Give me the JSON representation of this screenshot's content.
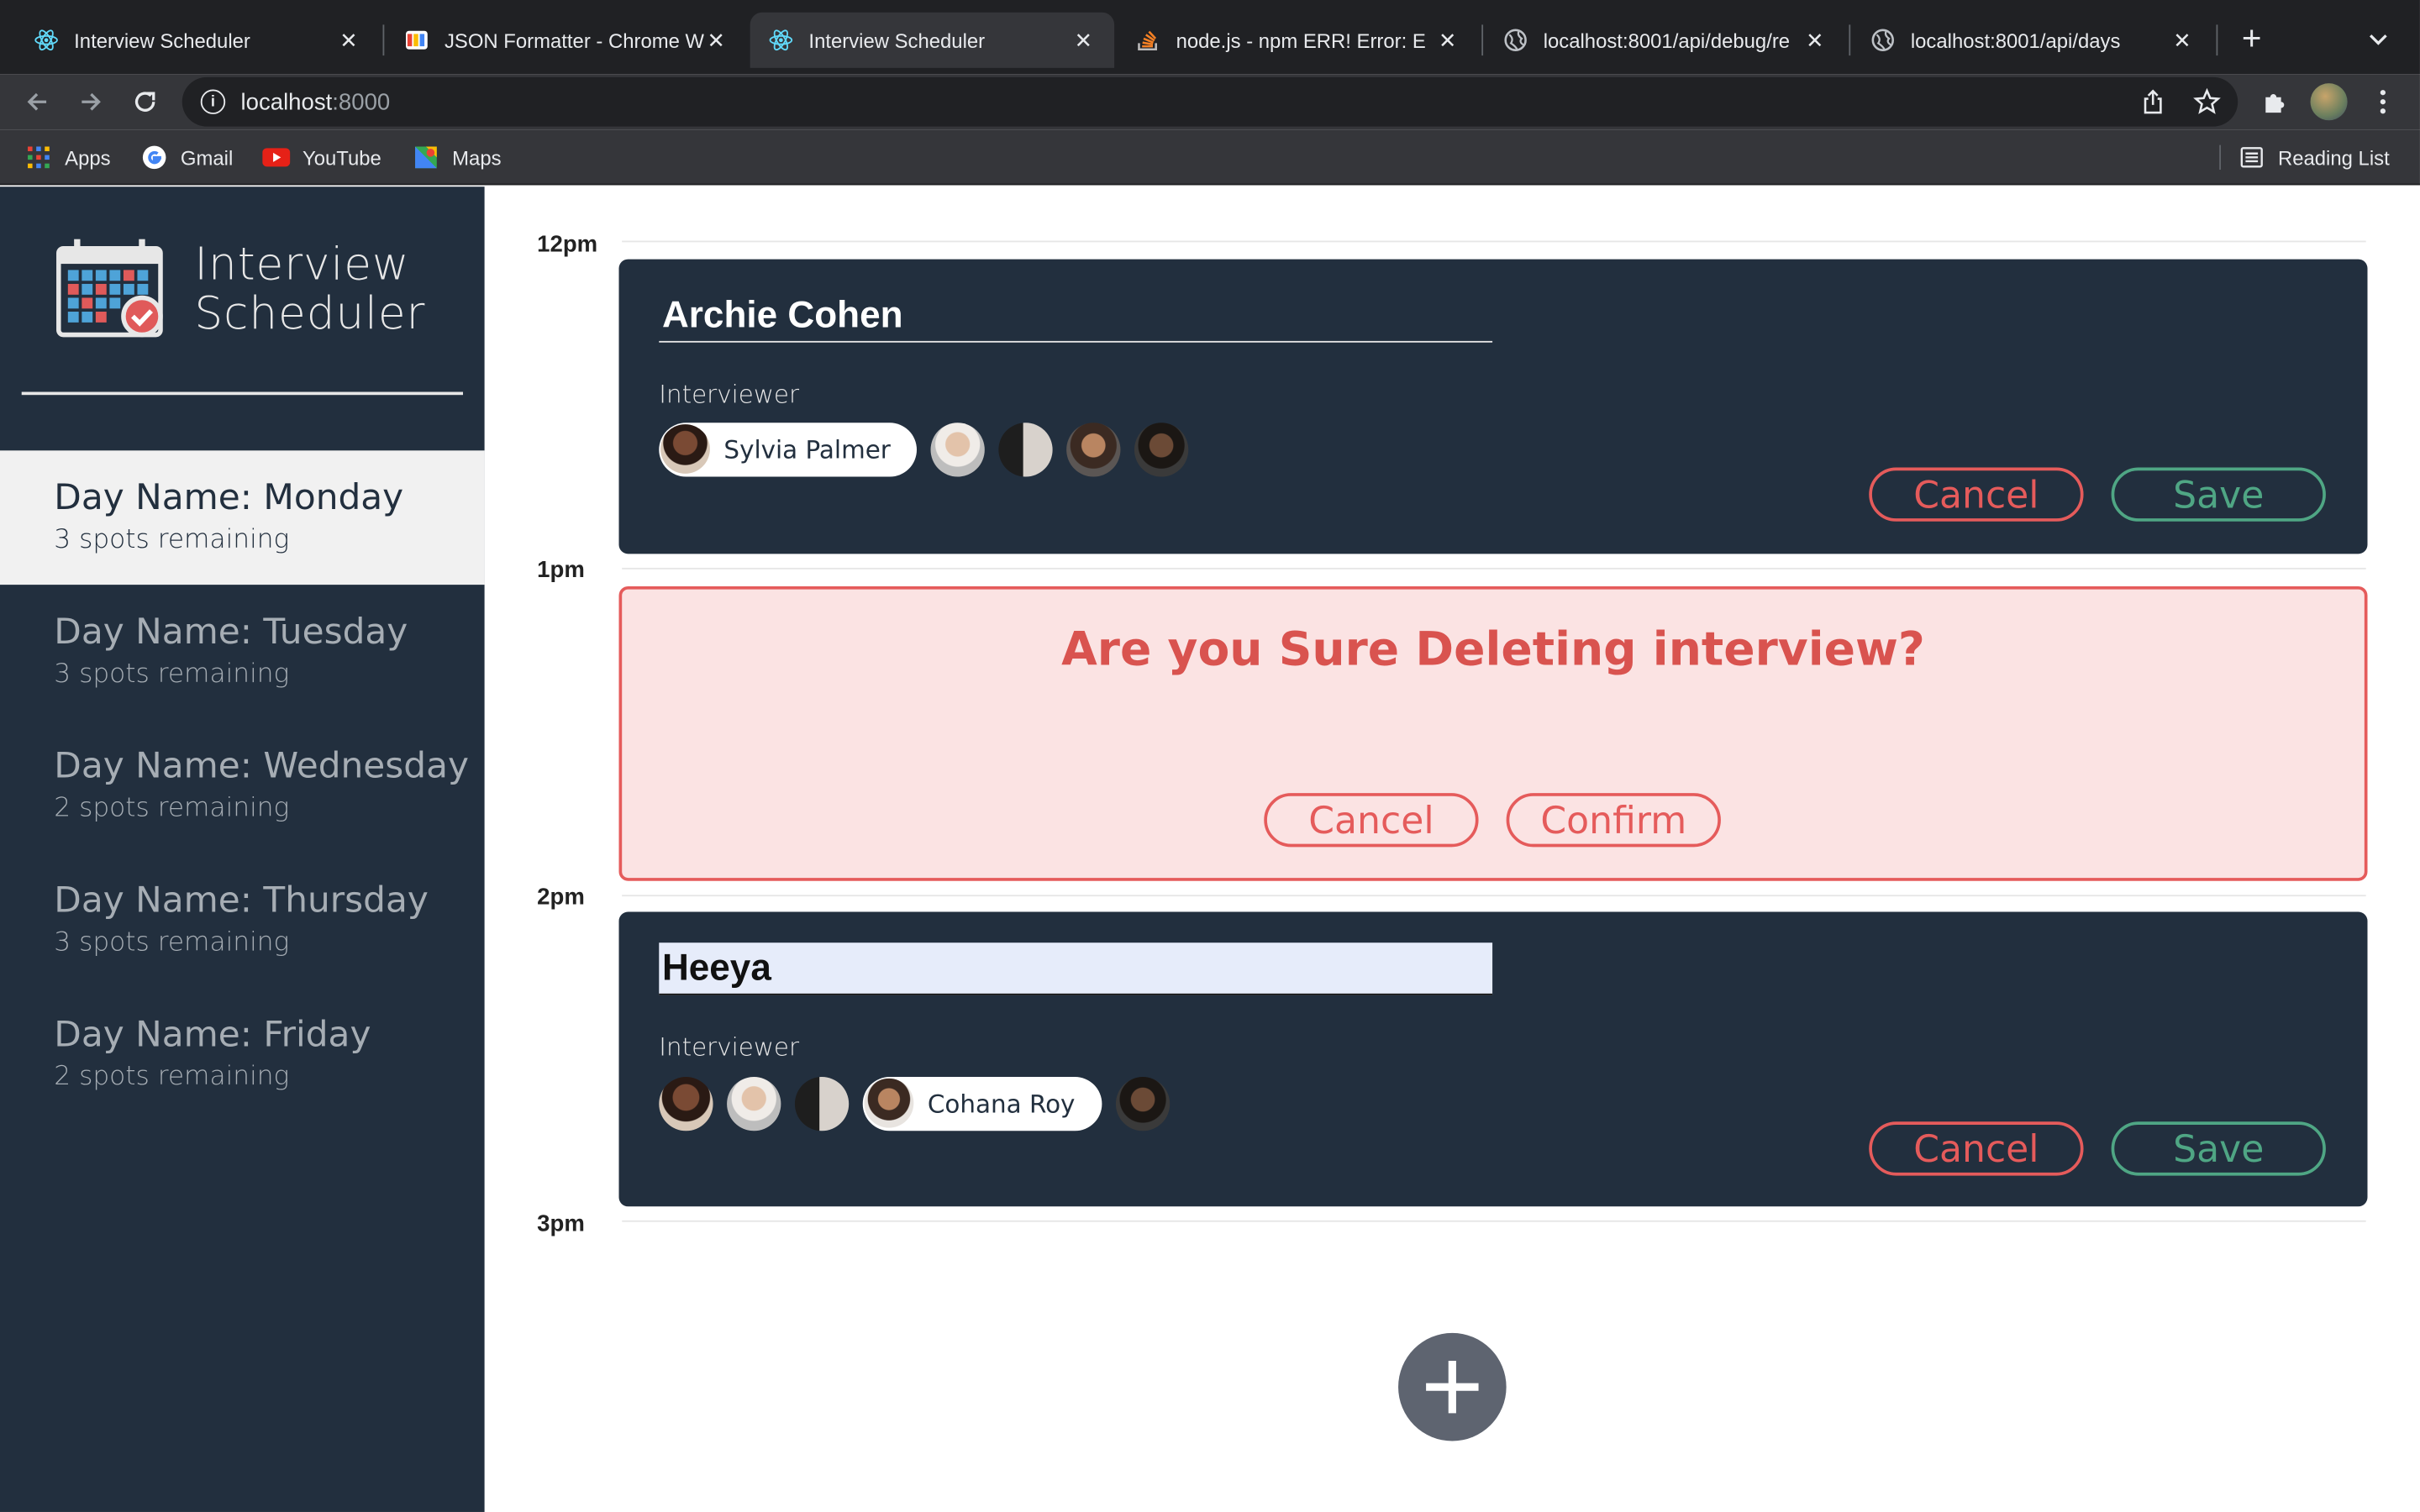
{
  "browser": {
    "tabs": [
      {
        "title": "Interview Scheduler",
        "favicon": "react-icon",
        "active": false
      },
      {
        "title": "JSON Formatter - Chrome W",
        "favicon": "json-formatter-icon",
        "active": false
      },
      {
        "title": "Interview Scheduler",
        "favicon": "react-icon",
        "active": true
      },
      {
        "title": "node.js - npm ERR! Error: E",
        "favicon": "stackoverflow-icon",
        "active": false
      },
      {
        "title": "localhost:8001/api/debug/re",
        "favicon": "globe-icon",
        "active": false
      },
      {
        "title": "localhost:8001/api/days",
        "favicon": "globe-icon",
        "active": false
      }
    ],
    "address": {
      "host": "localhost",
      "port": ":8000"
    },
    "bookmarks": [
      {
        "label": "Apps",
        "icon": "apps-grid-icon"
      },
      {
        "label": "Gmail",
        "icon": "google-icon"
      },
      {
        "label": "YouTube",
        "icon": "youtube-icon"
      },
      {
        "label": "Maps",
        "icon": "maps-icon"
      }
    ],
    "reading_list": "Reading List"
  },
  "app": {
    "brand": {
      "line1": "Interview",
      "line2": "Scheduler"
    },
    "days": [
      {
        "name": "Day Name: Monday",
        "spots": "3 spots remaining",
        "selected": true
      },
      {
        "name": "Day Name: Tuesday",
        "spots": "3 spots remaining",
        "selected": false
      },
      {
        "name": "Day Name: Wednesday",
        "spots": "2 spots remaining",
        "selected": false
      },
      {
        "name": "Day Name: Thursday",
        "spots": "3 spots remaining",
        "selected": false
      },
      {
        "name": "Day Name: Friday",
        "spots": "2 spots remaining",
        "selected": false
      }
    ],
    "hours": [
      "12pm",
      "1pm",
      "2pm",
      "3pm"
    ],
    "appointments": [
      {
        "student": "Archie Cohen",
        "interviewer_label": "Interviewer",
        "selected_interviewer": "Sylvia Palmer",
        "cancel": "Cancel",
        "save": "Save"
      },
      {
        "message": "Are you Sure Deleting interview?",
        "cancel": "Cancel",
        "confirm": "Confirm"
      },
      {
        "student": "Heeya",
        "interviewer_label": "Interviewer",
        "selected_interviewer": "Cohana Roy",
        "cancel": "Cancel",
        "save": "Save"
      }
    ]
  }
}
